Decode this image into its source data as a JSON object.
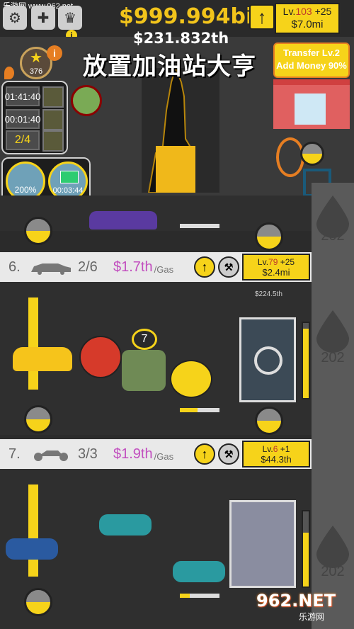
{
  "top": {
    "money": "$999.994bi",
    "per_sec": "$231.832th",
    "title": "放置加油站大亨",
    "main_level": {
      "prefix": "Lv.",
      "level": "103",
      "plus": "+25",
      "cost": "$7.0mi"
    }
  },
  "panel": {
    "rating": "376",
    "timers": [
      "01:41:40",
      "00:01:40"
    ],
    "ratio": "2/4",
    "boost_pct": "200%",
    "cash_timer": "00:03:44"
  },
  "station": {
    "transfer": "Transfer Lv.2",
    "add_money": "Add Money 90%"
  },
  "zombie_count": "7",
  "floating_cash": "$224.5th",
  "lanes": [
    {
      "num": "6.",
      "count": "2/6",
      "income": "$1.7th",
      "unit": "/Gas",
      "level": "79",
      "plus": "+25",
      "cost": "$2.4mi",
      "progress": 0.3
    },
    {
      "num": "7.",
      "count": "3/3",
      "income": "$1.9th",
      "unit": "/Gas",
      "level": "6",
      "plus": "+1",
      "cost": "$44.3th",
      "progress": 0.25
    }
  ],
  "sidebar": {
    "drop_values": [
      "202",
      "202",
      "202"
    ]
  },
  "watermark": {
    "text": "962.NET",
    "sub": "乐游网"
  },
  "corner_url": "乐游网 www.962.net",
  "colors": {
    "gold": "#f6d31a",
    "income": "#c24fbf",
    "level": "#c0392b"
  }
}
